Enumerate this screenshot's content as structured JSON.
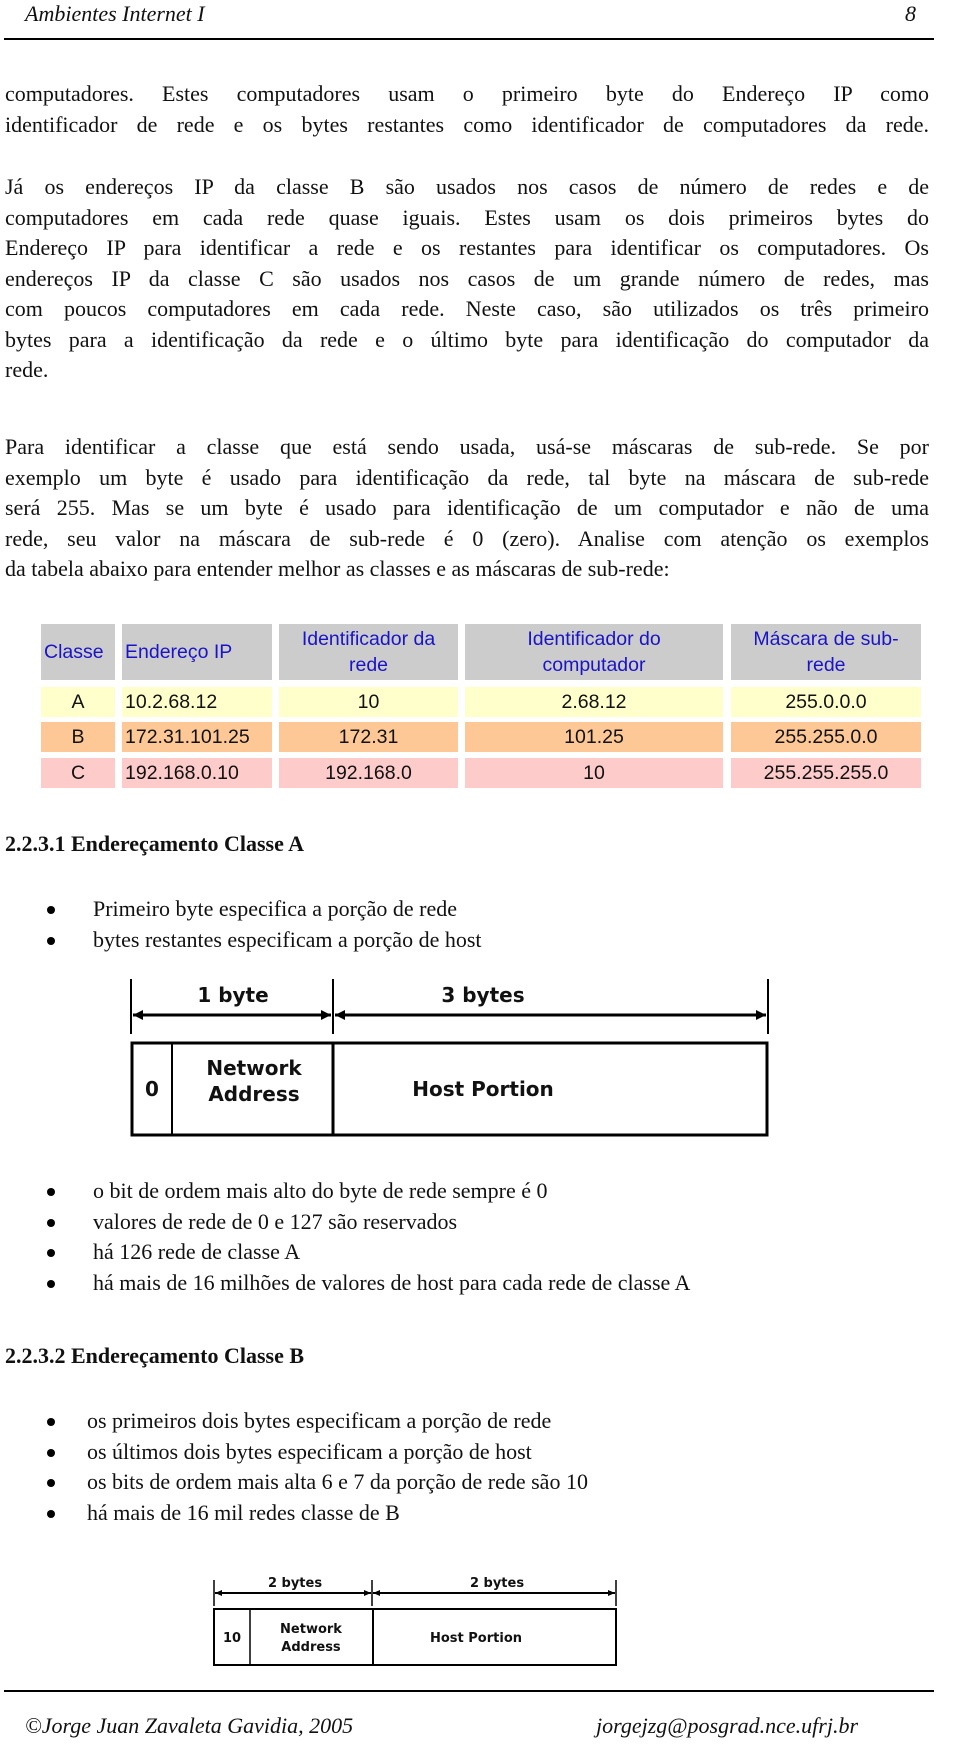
{
  "header": {
    "title": "Ambientes Internet I",
    "page_number": "8"
  },
  "paragraphs": [
    {
      "lines": [
        "computadores. Estes computadores usam o primeiro byte do Endereço IP como",
        "identificador de rede e os bytes restantes como identificador de computadores da rede."
      ]
    },
    {
      "lines": [
        "Já os endereços IP da classe B são usados nos casos de número de redes e de",
        "computadores em cada rede quase iguais. Estes usam os dois primeiros bytes do",
        "Endereço IP para identificar a rede e os restantes para identificar os computadores. Os",
        "endereços IP da classe C são usados nos casos de um grande número de redes, mas",
        "com poucos computadores em cada rede. Neste caso, são utilizados os três primeiro",
        "bytes para a identificação da rede e o último byte para identificação do computador da",
        "rede."
      ]
    },
    {
      "lines": [
        "Para identificar a classe que está sendo usada, usá-se máscaras de sub-rede. Se por",
        "exemplo um byte é usado para identificação da rede, tal byte na máscara de sub-rede",
        "será 255. Mas se um byte é usado para identificação de um computador e não de uma",
        "rede, seu valor na máscara de sub-rede é 0 (zero). Analise com atenção os exemplos",
        "da tabela abaixo para entender melhor as classes e as máscaras de sub-rede:"
      ]
    }
  ],
  "table": {
    "headers": [
      "Classe",
      "Endereço IP",
      "Identificador da rede",
      "Identificador do computador",
      "Máscara de sub-rede"
    ],
    "header_lines": [
      [
        "Classe"
      ],
      [
        "Endereço IP"
      ],
      [
        "Identificador da",
        "rede"
      ],
      [
        "Identificador do",
        "computador"
      ],
      [
        "Máscara de sub-",
        "rede"
      ]
    ],
    "rows": [
      [
        "A",
        "10.2.68.12",
        "10",
        "2.68.12",
        "255.0.0.0"
      ],
      [
        "B",
        "172.31.101.25",
        "172.31",
        "101.25",
        "255.255.0.0"
      ],
      [
        "C",
        "192.168.0.10",
        "192.168.0",
        "10",
        "255.255.255.0"
      ]
    ],
    "colors": {
      "header_bg": "#cccccc",
      "header_text": "#1a14c8",
      "row_a_bg": "#ffffcc",
      "row_b_bg": "#fdc896",
      "row_c_bg": "#fecbcb"
    }
  },
  "section_a": {
    "title": "2.2.3.1 Endereçamento Classe A",
    "bullets_top": [
      "Primeiro byte especifica a porção de rede",
      "bytes restantes especificam a porção de host"
    ],
    "diagram": {
      "left_span_label": "1 byte",
      "right_span_label": "3 bytes",
      "bit_label": "0",
      "network_label_lines": [
        "Network",
        "Address"
      ],
      "host_label": "Host Portion"
    },
    "bullets_bottom": [
      "o bit de ordem mais alto do byte de rede sempre é 0",
      "valores de rede de 0 e 127 são reservados",
      "há 126 rede de classe A",
      "há mais de 16 milhões de valores de host para cada rede de classe A"
    ]
  },
  "section_b": {
    "title": "2.2.3.2 Endereçamento Classe B",
    "bullets": [
      "os primeiros dois bytes especificam a porção de rede",
      "os últimos dois bytes especificam a porção de host",
      "os bits de ordem mais alta 6 e 7 da porção de rede são 10",
      "há mais de 16 mil redes classe de B"
    ],
    "diagram": {
      "left_span_label": "2 bytes",
      "right_span_label": "2 bytes",
      "bit_label": "10",
      "network_label_lines": [
        "Network",
        "Address"
      ],
      "host_label": "Host Portion"
    }
  },
  "footer": {
    "copyright": "©Jorge Juan Zavaleta Gavidia, 2005",
    "email": "jorgejzg@posgrad.nce.ufrj.br"
  }
}
